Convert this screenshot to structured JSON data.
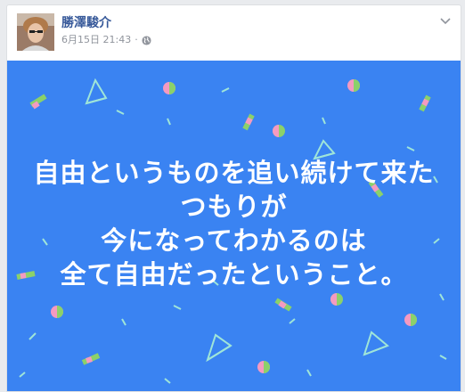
{
  "post": {
    "author_name": "勝澤駿介",
    "date": "6月15日 21:43",
    "separator": "·",
    "privacy_icon": "globe-icon",
    "menu_icon": "chevron-down-icon"
  },
  "image": {
    "background_color": "#3a83f2",
    "lines": [
      "自由というものを追い続けて来た",
      "つもりが",
      "今になってわかるのは",
      "全て自由だったということ。"
    ]
  }
}
